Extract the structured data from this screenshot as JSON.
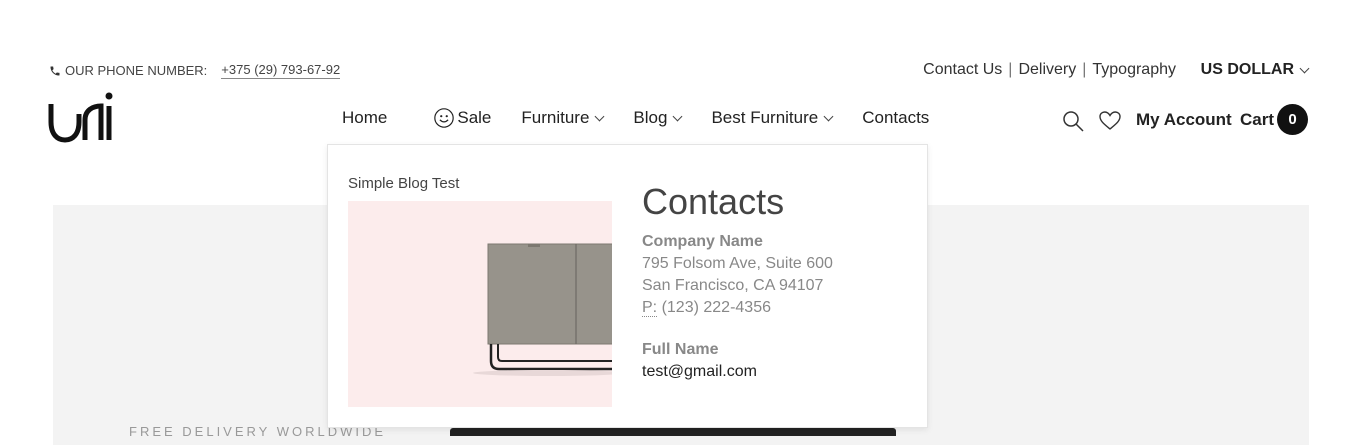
{
  "topbar": {
    "phone_label": "OUR PHONE NUMBER:",
    "phone_number": "+375 (29) 793-67-92",
    "links": [
      "Contact Us",
      "Delivery",
      "Typography"
    ],
    "separator": "|",
    "currency": "US DOLLAR"
  },
  "nav": {
    "items": [
      {
        "label": "Home"
      },
      {
        "label": "Sale"
      },
      {
        "label": "Furniture"
      },
      {
        "label": "Blog"
      },
      {
        "label": "Best Furniture"
      },
      {
        "label": "Contacts"
      }
    ]
  },
  "header_right": {
    "account_label": "My Account",
    "cart_label": "Cart",
    "cart_count": "0"
  },
  "dropdown": {
    "blog_title": "Simple Blog Test",
    "contacts_heading": "Contacts",
    "company_name": "Company Name",
    "address_line1": "795 Folsom Ave, Suite 600",
    "address_line2": "San Francisco, CA 94107",
    "phone_prefix": "P:",
    "phone": "(123) 222-4356",
    "full_name": "Full Name",
    "email": "test@gmail.com"
  },
  "hero": {
    "tagline": "FREE DELIVERY WORLDWIDE"
  },
  "colors": {
    "accent": "#111111",
    "hero_bg": "#f3f3f3",
    "blog_img_bg": "#fcecec"
  }
}
